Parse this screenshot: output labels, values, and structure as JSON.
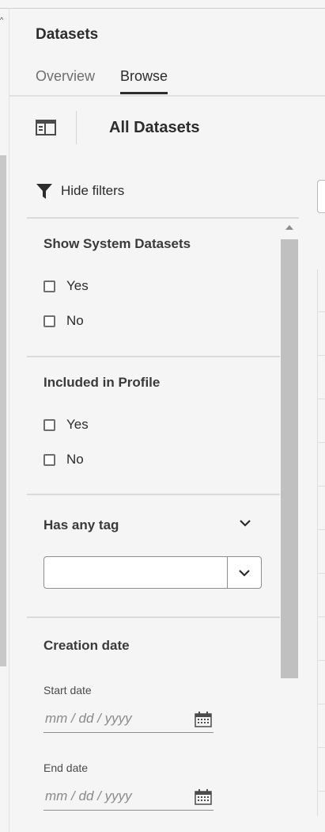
{
  "app": {
    "title": "Datasets"
  },
  "tabs": [
    {
      "label": "Overview",
      "active": false
    },
    {
      "label": "Browse",
      "active": true
    }
  ],
  "browse": {
    "title": "All Datasets"
  },
  "filters": {
    "toggle_label": "Hide filters",
    "system_datasets": {
      "title": "Show System Datasets",
      "options": [
        "Yes",
        "No"
      ]
    },
    "included_in_profile": {
      "title": "Included in Profile",
      "options": [
        "Yes",
        "No"
      ]
    },
    "has_any_tag": {
      "title": "Has any tag",
      "value": ""
    },
    "creation_date": {
      "title": "Creation date",
      "start_label": "Start date",
      "start_placeholder": "mm / dd / yyyy",
      "end_label": "End date",
      "end_placeholder": "mm / dd / yyyy"
    }
  },
  "icons": [
    "panel-toggle-icon",
    "filter-icon",
    "chevron-down-icon",
    "calendar-icon",
    "scroll-up-icon"
  ],
  "colors": {
    "text": "#2c2c2c",
    "muted": "#6e6e6e",
    "background": "#f5f5f5",
    "scrollbar": "#c0c0c0"
  }
}
